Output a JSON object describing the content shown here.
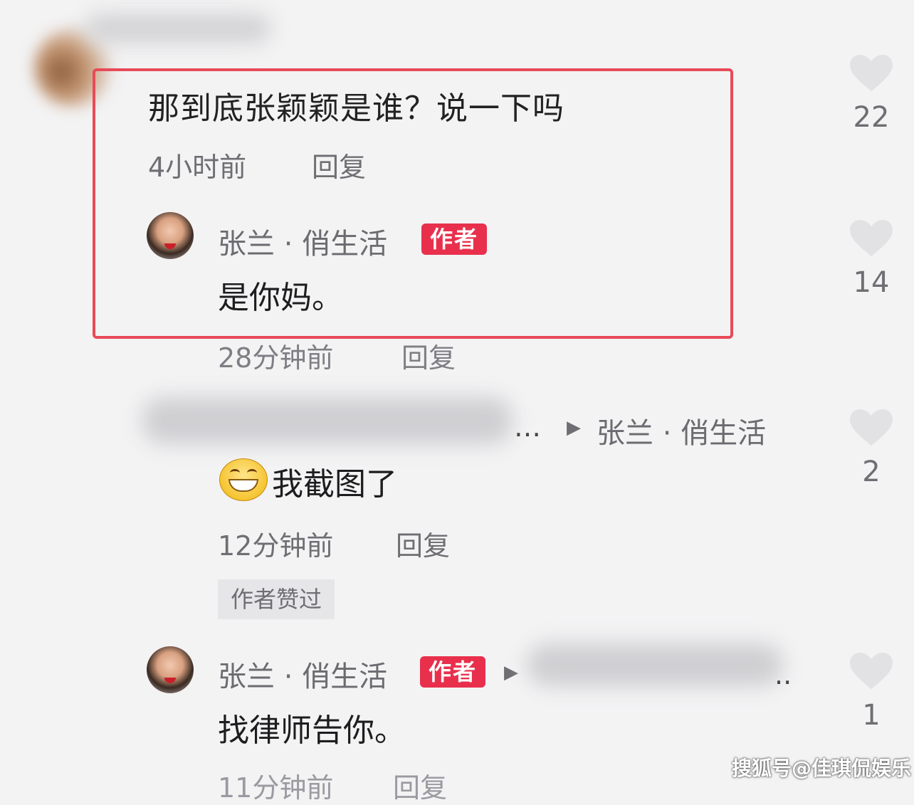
{
  "comment_top": {
    "text": "那到底张颖颖是谁？说一下吗",
    "time": "4小时前",
    "reply_label": "回复",
    "likes": "22"
  },
  "reply_1": {
    "author": "张兰 · 俏生活",
    "badge": "作者",
    "text": "是你妈。",
    "time": "28分钟前",
    "reply_label": "回复",
    "likes": "14"
  },
  "reply_2": {
    "author_blurred": "…",
    "reply_to": "张兰 · 俏生活",
    "text": "我截图了",
    "time": "12分钟前",
    "reply_label": "回复",
    "liked_tag": "作者赞过",
    "likes": "2"
  },
  "reply_3": {
    "author": "张兰 · 俏生活",
    "badge": "作者",
    "reply_to_blurred": "..",
    "text": "找律师告你。",
    "time": "11分钟前",
    "reply_label": "回复",
    "likes": "1"
  },
  "watermark": "搜狐号@佳琪侃娱乐",
  "icons": {
    "like": "heart-icon",
    "arrow": "play-arrow-icon",
    "emoji": "grin-emoji-icon"
  },
  "colors": {
    "highlight_border": "#e84a58",
    "author_badge": "#e8304c"
  }
}
